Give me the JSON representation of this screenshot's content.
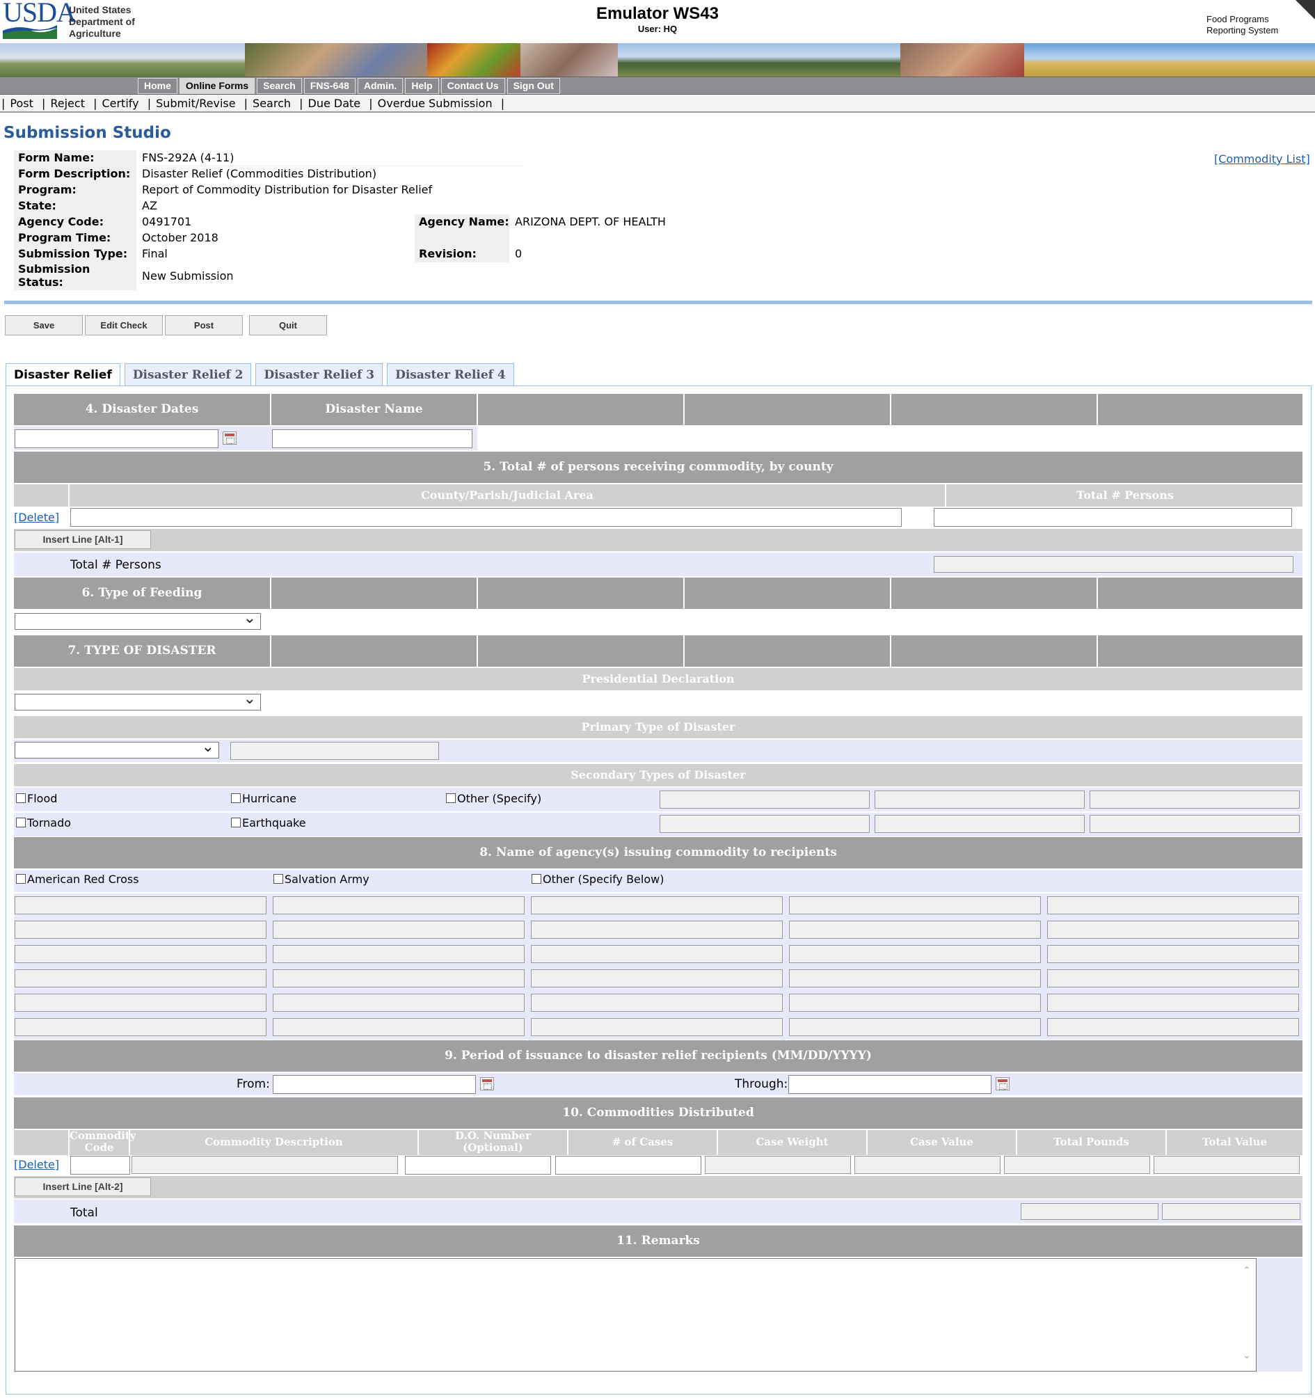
{
  "header": {
    "logo_text": "USDA",
    "dept_lines": [
      "United States",
      "Department of",
      "Agriculture"
    ],
    "title": "Emulator WS43",
    "user": "User: HQ",
    "system_lines": [
      "Food Programs",
      "Reporting System"
    ]
  },
  "nav": {
    "buttons": [
      "Home",
      "Online Forms",
      "Search",
      "FNS-648",
      "Admin.",
      "Help",
      "Contact Us",
      "Sign Out"
    ],
    "active": "Online Forms"
  },
  "subnav": [
    "Post",
    "Reject",
    "Certify",
    "Submit/Revise",
    "Search",
    "Due Date",
    "Overdue Submission"
  ],
  "studio": {
    "title": "Submission Studio",
    "commodity_list_link": "[Commodity List]",
    "fields": {
      "form_name_label": "Form Name:",
      "form_name": "FNS-292A (4-11)",
      "form_desc_label": "Form Description:",
      "form_desc": "Disaster Relief (Commodities Distribution)",
      "program_label": "Program:",
      "program": "Report of Commodity Distribution for Disaster Relief",
      "state_label": "State:",
      "state": "AZ",
      "agency_code_label": "Agency Code:",
      "agency_code": "0491701",
      "agency_name_label": "Agency Name:",
      "agency_name": "ARIZONA DEPT. OF HEALTH",
      "program_time_label": "Program Time:",
      "program_time": "October 2018",
      "submission_type_label": "Submission Type:",
      "submission_type": "Final",
      "revision_label": "Revision:",
      "revision": "0",
      "submission_status_label_1": "Submission",
      "submission_status_label_2": "Status:",
      "submission_status": "New Submission"
    }
  },
  "actions": [
    "Save",
    "Edit Check",
    "Post",
    "Quit"
  ],
  "tabs": [
    "Disaster Relief",
    "Disaster Relief 2",
    "Disaster Relief 3",
    "Disaster Relief 4"
  ],
  "form": {
    "s4_dates": "4. Disaster Dates",
    "s4_name": "Disaster Name",
    "s5_title": "5. Total # of persons receiving commodity, by county",
    "s5_county": "County/Parish/Judicial Area",
    "s5_total": "Total # Persons",
    "delete": "[Delete]",
    "insert1": "Insert Line [Alt-1]",
    "total_persons": "Total # Persons",
    "s6_title": "6. Type of Feeding",
    "s7_title": "7. TYPE OF DISASTER",
    "presidential": "Presidential Declaration",
    "primary": "Primary Type of Disaster",
    "secondary": "Secondary Types of Disaster",
    "flood": "Flood",
    "hurricane": "Hurricane",
    "other_specify": "Other (Specify)",
    "tornado": "Tornado",
    "earthquake": "Earthquake",
    "s8_title": "8. Name of agency(s) issuing commodity to recipients",
    "red_cross": "American Red Cross",
    "salvation": "Salvation Army",
    "other_below": "Other (Specify Below)",
    "s9_title": "9. Period of issuance to disaster relief recipients (MM/DD/YYYY)",
    "from": "From:",
    "through": "Through:",
    "s10_title": "10. Commodities Distributed",
    "cols": [
      "Commodity",
      "Code",
      "Commodity Description",
      "D.O. Number",
      "(Optional)",
      "# of Cases",
      "Case Weight",
      "Case Value",
      "Total Pounds",
      "Total Value"
    ],
    "insert2": "Insert Line [Alt-2]",
    "total": "Total",
    "s11_title": "11. Remarks"
  }
}
